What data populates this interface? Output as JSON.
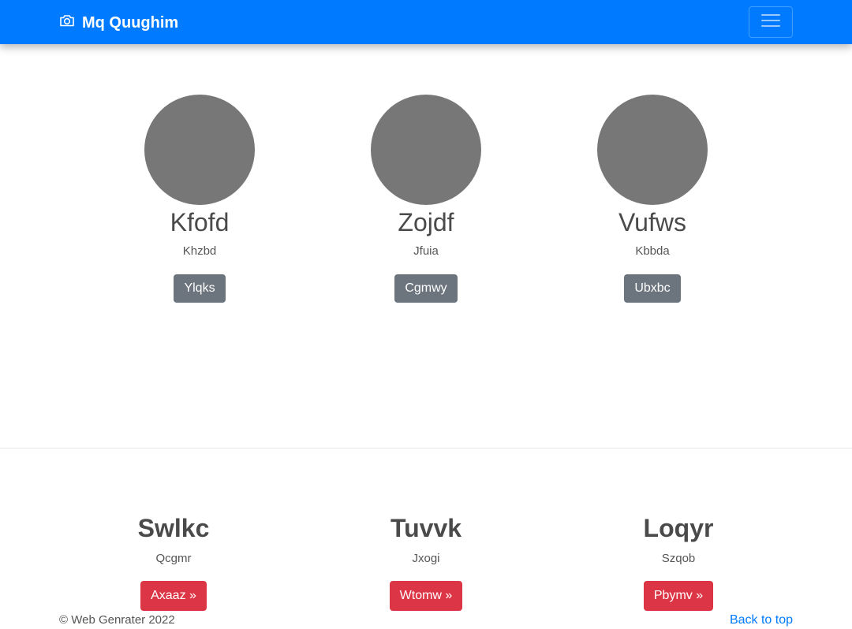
{
  "navbar": {
    "brand": "Mq Quughim",
    "brand_icon": "camera-icon",
    "toggler_icon": "hamburger-menu-icon",
    "color": "#007bff"
  },
  "team": [
    {
      "name": "Kfofd",
      "role": "Khzbd",
      "button": "Ylqks"
    },
    {
      "name": "Zojdf",
      "role": "Jfuia",
      "button": "Cgmwy"
    },
    {
      "name": "Vufws",
      "role": "Kbbda",
      "button": "Ubxbc"
    }
  ],
  "features": [
    {
      "title": "Swlkc",
      "text": "Qcgmr",
      "button": "Axaaz »"
    },
    {
      "title": "Tuvvk",
      "text": "Jxogi",
      "button": "Wtomw »"
    },
    {
      "title": "Loqyr",
      "text": "Szqob",
      "button": "Pbymv »"
    }
  ],
  "footer": {
    "copyright": "© Web Genrater 2022",
    "back_to_top": "Back to top"
  },
  "colors": {
    "primary": "#007bff",
    "secondary": "#6c757d",
    "danger": "#dc3545",
    "avatar": "#777777"
  }
}
